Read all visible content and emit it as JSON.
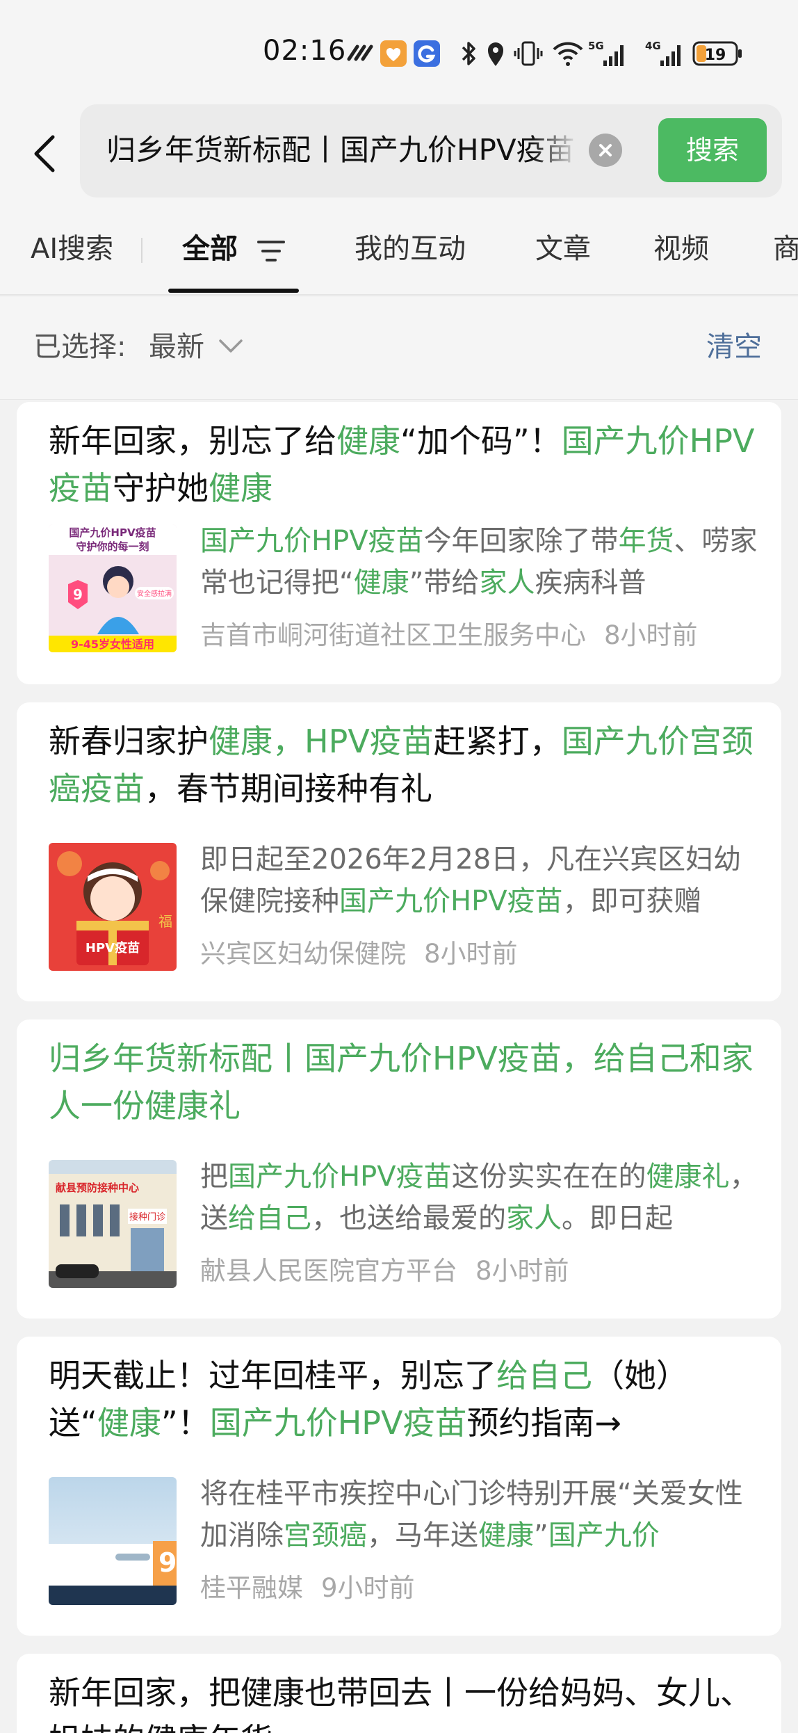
{
  "status_bar": {
    "time": "02:16",
    "battery": "19",
    "network_5g": "5G",
    "network_4g": "4G"
  },
  "search": {
    "query": "归乡年货新标配丨国产九价HPV疫苗，给自己和家人一份健康礼",
    "button_label": "搜索"
  },
  "tabs": [
    {
      "label": "AI搜索"
    },
    {
      "label": "全部"
    },
    {
      "label": "我的互动"
    },
    {
      "label": "文章"
    },
    {
      "label": "视频"
    },
    {
      "label": "商品"
    }
  ],
  "filter": {
    "label": "已选择:",
    "value": "最新",
    "clear_label": "清空"
  },
  "results": [
    {
      "title": [
        {
          "t": "新年回家，别忘了给"
        },
        {
          "t": "健康",
          "hl": true
        },
        {
          "t": "“加个码”！"
        },
        {
          "t": "国产九价HPV疫苗",
          "hl": true
        },
        {
          "t": "守护她"
        },
        {
          "t": "健康",
          "hl": true
        }
      ],
      "snippet": [
        {
          "t": "国产九价HPV疫苗",
          "hl": true
        },
        {
          "t": "今年回家除了带"
        },
        {
          "t": "年货",
          "hl": true
        },
        {
          "t": "、唠家常也记得把“"
        },
        {
          "t": "健康",
          "hl": true
        },
        {
          "t": "”带给"
        },
        {
          "t": "家人",
          "hl": true
        },
        {
          "t": "疾病科普"
        }
      ],
      "source": "吉首市峒河街道社区卫生服务中心",
      "time": "8小时前",
      "thumb": {
        "line1": "国产九价HPV疫苗",
        "line2": "守护你的每一刻",
        "badge": "9",
        "tag": "安全感拉满",
        "footer": "9-45岁女性适用"
      }
    },
    {
      "title": [
        {
          "t": "新春归家护"
        },
        {
          "t": "健康，HPV疫苗",
          "hl": true
        },
        {
          "t": "赶紧打，"
        },
        {
          "t": "国产九价宫颈癌疫苗",
          "hl": true
        },
        {
          "t": "，春节期间接种有礼"
        }
      ],
      "snippet": [
        {
          "t": "即日起至2026年2月28日，凡在兴宾区妇幼保健院接种"
        },
        {
          "t": "国产九价HPV疫苗",
          "hl": true
        },
        {
          "t": "，即可获赠"
        }
      ],
      "source": "兴宾区妇幼保健院",
      "time": "8小时前",
      "thumb": {
        "box_label": "HPV疫苗",
        "fu": "福"
      }
    },
    {
      "title": [
        {
          "t": "归乡年货新标配丨国产九价HPV疫苗，给自己和家人一份健康礼",
          "hl": true
        }
      ],
      "snippet": [
        {
          "t": "把"
        },
        {
          "t": "国产九价HPV疫苗",
          "hl": true
        },
        {
          "t": "这份实实在在的"
        },
        {
          "t": "健康礼",
          "hl": true
        },
        {
          "t": "，送"
        },
        {
          "t": "给自己",
          "hl": true
        },
        {
          "t": "，也送给最爱的"
        },
        {
          "t": "家人",
          "hl": true
        },
        {
          "t": "。即日起"
        }
      ],
      "source": "献县人民医院官方平台",
      "time": "8小时前",
      "thumb": {
        "sign": "献县预防接种中心",
        "door": "接种门诊"
      }
    },
    {
      "title": [
        {
          "t": "明天截止！过年回桂平，别忘了"
        },
        {
          "t": "给自己",
          "hl": true
        },
        {
          "t": "（她）送“"
        },
        {
          "t": "健康",
          "hl": true
        },
        {
          "t": "”！"
        },
        {
          "t": "国产九价HPV疫苗",
          "hl": true
        },
        {
          "t": "预约指南→"
        }
      ],
      "snippet": [
        {
          "t": "将在桂平市疾控中心门诊特别开展“关爱女性加消除"
        },
        {
          "t": "宫颈癌",
          "hl": true
        },
        {
          "t": "，马年送"
        },
        {
          "t": "健康",
          "hl": true
        },
        {
          "t": "”"
        },
        {
          "t": "国产九价",
          "hl": true
        }
      ],
      "source": "桂平融媒",
      "time": "9小时前",
      "thumb": {
        "badge": "9"
      }
    },
    {
      "title": [
        {
          "t": "新年回家，把健康也带回去丨一份给妈妈、女儿、姐妹的健康年货"
        }
      ]
    }
  ]
}
